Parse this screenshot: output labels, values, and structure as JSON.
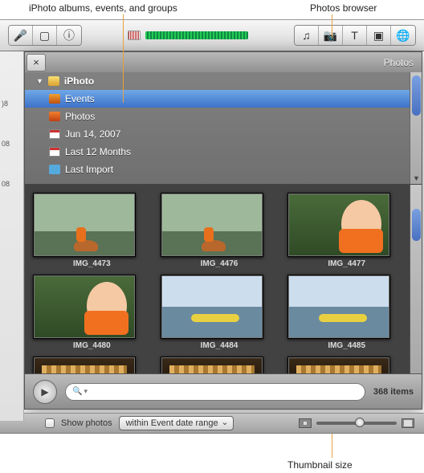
{
  "annotations": {
    "top_left": "iPhoto albums, events, and groups",
    "top_right": "Photos browser",
    "bottom": "Thumbnail size"
  },
  "toolbar": {
    "icons": {
      "voice": "voice-memo-icon",
      "crop": "crop-icon",
      "info": "info-icon",
      "audio": "audio-level-icon",
      "music": "music-icon",
      "camera": "camera-icon",
      "text": "text-icon",
      "transition": "transition-icon",
      "globe": "globe-icon"
    }
  },
  "panel": {
    "close_glyph": "×",
    "title": "Photos"
  },
  "tree": {
    "root": "iPhoto",
    "items": [
      {
        "label": "Events",
        "selected": true
      },
      {
        "label": "Photos",
        "selected": false
      },
      {
        "label": "Jun 14, 2007",
        "selected": false
      },
      {
        "label": "Last 12 Months",
        "selected": false
      },
      {
        "label": "Last Import",
        "selected": false
      }
    ]
  },
  "thumbnails": {
    "row1": [
      {
        "name": "IMG_4473"
      },
      {
        "name": "IMG_4476"
      },
      {
        "name": "IMG_4477"
      }
    ],
    "row2": [
      {
        "name": "IMG_4480"
      },
      {
        "name": "IMG_4484"
      },
      {
        "name": "IMG_4485"
      }
    ]
  },
  "search": {
    "placeholder": "",
    "glyph": "🔍"
  },
  "status": {
    "count_label": "368 items"
  },
  "footer": {
    "show_photos_label": "Show photos",
    "popup_value": "within Event date range"
  },
  "left_rail": {
    "marks": [
      ")8",
      "08",
      "08"
    ]
  }
}
